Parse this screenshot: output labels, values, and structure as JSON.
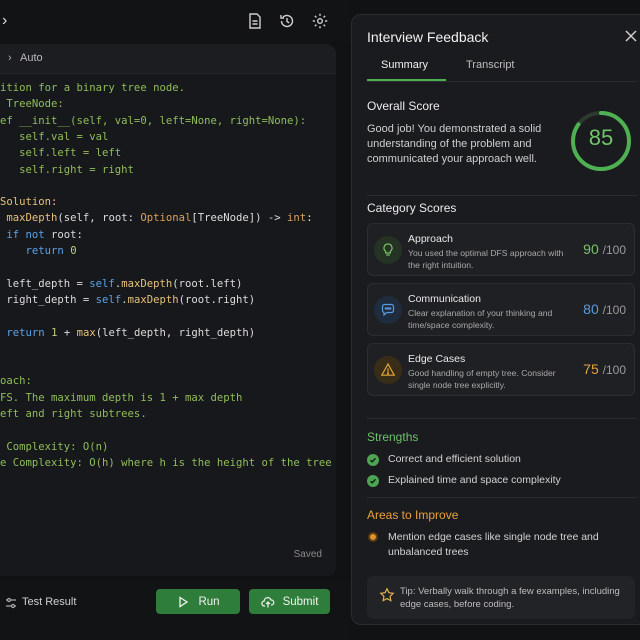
{
  "toolbar": {
    "icons": [
      "document-icon",
      "history-icon",
      "settings-icon"
    ]
  },
  "editor": {
    "language": "Auto",
    "status": "Saved",
    "code": [
      [
        [
          "cm",
          "ition for a binary tree node."
        ]
      ],
      [
        [
          "cm",
          " TreeNode:"
        ]
      ],
      [
        [
          "cm",
          "ef __init__(self, val=0, left=None, right=None):"
        ]
      ],
      [
        [
          "cm",
          "   self.val = val"
        ]
      ],
      [
        [
          "cm",
          "   self.left = left"
        ]
      ],
      [
        [
          "cm",
          "   self.right = right"
        ]
      ],
      [],
      [
        [
          "fn",
          "Solution:"
        ]
      ],
      [
        [
          "tx",
          " "
        ],
        [
          "fn",
          "maxDepth"
        ],
        [
          "tx",
          "(self, root: "
        ],
        [
          "ty",
          "Optional"
        ],
        [
          "tx",
          "[TreeNode]) -> "
        ],
        [
          "ty",
          "int"
        ],
        [
          "tx",
          ":"
        ]
      ],
      [
        [
          "tx",
          " "
        ],
        [
          "kw",
          "if not"
        ],
        [
          "tx",
          " root:"
        ]
      ],
      [
        [
          "tx",
          "    "
        ],
        [
          "kw",
          "return"
        ],
        [
          "tx",
          " "
        ],
        [
          "num",
          "0"
        ]
      ],
      [],
      [
        [
          "tx",
          " left_depth = "
        ],
        [
          "kw",
          "self"
        ],
        [
          "tx",
          "."
        ],
        [
          "fn",
          "maxDepth"
        ],
        [
          "tx",
          "(root.left)"
        ]
      ],
      [
        [
          "tx",
          " right_depth = "
        ],
        [
          "kw",
          "self"
        ],
        [
          "tx",
          "."
        ],
        [
          "fn",
          "maxDepth"
        ],
        [
          "tx",
          "(root.right)"
        ]
      ],
      [],
      [
        [
          "tx",
          " "
        ],
        [
          "kw",
          "return"
        ],
        [
          "tx",
          " "
        ],
        [
          "num",
          "1"
        ],
        [
          "tx",
          " + "
        ],
        [
          "fn",
          "max"
        ],
        [
          "tx",
          "(left_depth, right_depth)"
        ]
      ],
      [],
      [],
      [
        [
          "cm",
          "oach:"
        ]
      ],
      [
        [
          "cm",
          "FS. The maximum depth is 1 + max depth"
        ]
      ],
      [
        [
          "cm",
          "eft and right subtrees."
        ]
      ],
      [],
      [
        [
          "cm",
          " Complexity: O(n)"
        ]
      ],
      [
        [
          "cm",
          "e Complexity: O(h) where h is the height of the tree"
        ]
      ]
    ]
  },
  "bottombar": {
    "test_result_label": "Test Result",
    "run_label": "Run",
    "submit_label": "Submit"
  },
  "panel": {
    "title": "Interview Feedback",
    "tabs": [
      "Summary",
      "Transcript"
    ],
    "active_tab": "Summary",
    "overall": {
      "heading": "Overall Score",
      "text": "Good job! You demonstrated a solid understanding of the problem and communicated your approach well.",
      "score": "85",
      "score_fraction": 0.85
    },
    "categories_heading": "Category Scores",
    "categories": [
      {
        "title": "Approach",
        "desc": "You used the optimal DFS approach with the right intuition.",
        "score": "90",
        "max": "/100",
        "color": "#7cc26a",
        "icon": "lightbulb-icon"
      },
      {
        "title": "Communication",
        "desc": "Clear explanation of your thinking and time/space complexity.",
        "score": "80",
        "max": "/100",
        "color": "#5a9be0",
        "icon": "chat-bubble-icon"
      },
      {
        "title": "Edge Cases",
        "desc": "Good handling of empty tree. Consider single node tree explicitly.",
        "score": "75",
        "max": "/100",
        "color": "#e4a53a",
        "icon": "warning-icon"
      }
    ],
    "strengths_heading": "Strengths",
    "strengths": [
      "Correct and efficient solution",
      "Explained time and space complexity"
    ],
    "improve_heading": "Areas to Improve",
    "improvements": [
      "Mention edge cases like single node tree and unbalanced trees"
    ],
    "tip": "Tip: Verbally walk through a few examples, including edge cases, before coding."
  }
}
